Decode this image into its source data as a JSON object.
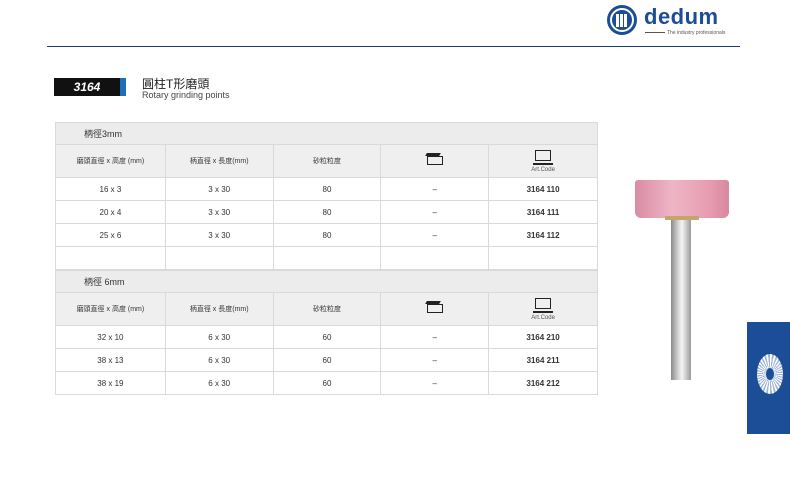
{
  "brand": {
    "name": "dedum",
    "tagline": "The industry professionals",
    "color": "#1c4e97"
  },
  "product": {
    "code": "3164",
    "title_zh": "圓柱T形磨頭",
    "title_en": "Rotary grinding points"
  },
  "headers": {
    "col1": "磨頭直徑 x 高度 (mm)",
    "col2": "柄直徑 x 長度(mm)",
    "col3": "砂粒粒度",
    "col4_icon": "box-icon",
    "col5_icon": "laptop-icon",
    "col5_label": "Art.Code"
  },
  "sections": [
    {
      "label": "柄徑3mm",
      "rows": [
        {
          "size": "16 x 3",
          "shank": "3 x 30",
          "grit": "80",
          "pack": "–",
          "art": "3164 110"
        },
        {
          "size": "20 x 4",
          "shank": "3 x 30",
          "grit": "80",
          "pack": "–",
          "art": "3164 111"
        },
        {
          "size": "25 x 6",
          "shank": "3 x 30",
          "grit": "80",
          "pack": "–",
          "art": "3164 112"
        }
      ]
    },
    {
      "label": "柄徑 6mm",
      "rows": [
        {
          "size": "32 x 10",
          "shank": "6 x 30",
          "grit": "60",
          "pack": "–",
          "art": "3164 210"
        },
        {
          "size": "38 x 13",
          "shank": "6 x 30",
          "grit": "60",
          "pack": "–",
          "art": "3164 211"
        },
        {
          "size": "38 x 19",
          "shank": "6 x 30",
          "grit": "60",
          "pack": "–",
          "art": "3164 212"
        }
      ]
    }
  ]
}
